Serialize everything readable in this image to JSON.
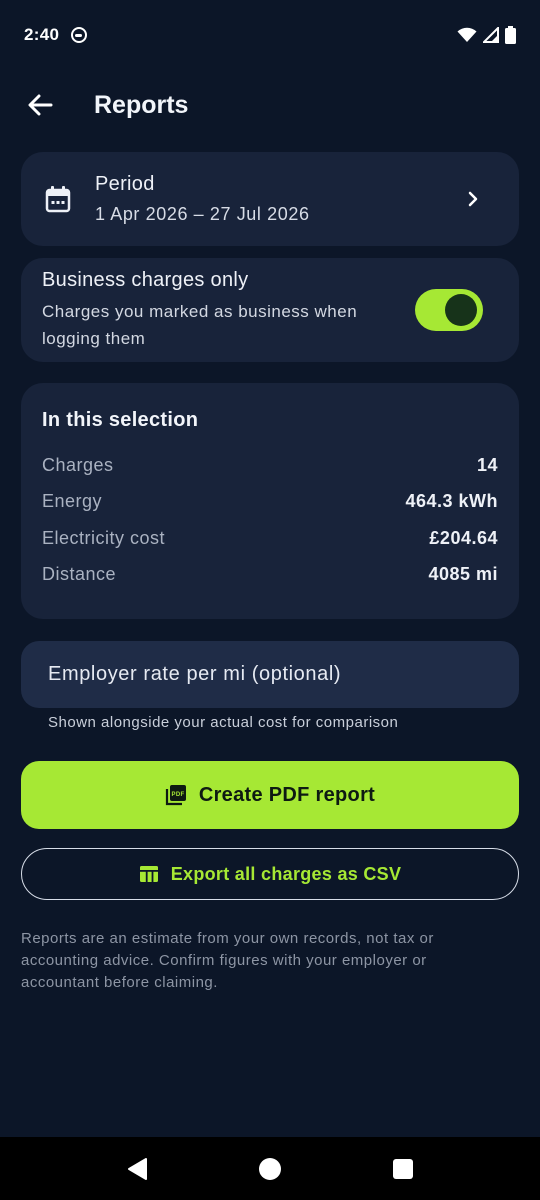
{
  "status_bar": {
    "time": "2:40",
    "icons": [
      "notification-icon",
      "wifi-icon",
      "signal-icon",
      "battery-icon"
    ]
  },
  "app_bar": {
    "title": "Reports",
    "back_icon": "arrow-back-icon"
  },
  "period": {
    "label": "Period",
    "value": "1 Apr 2026 – 27 Jul 2026",
    "icon": "calendar-icon"
  },
  "business_filter": {
    "title": "Business charges only",
    "subtitle": "Charges you marked as business when logging them",
    "enabled": true
  },
  "summary": {
    "title": "In this selection",
    "rows": [
      {
        "label": "Charges",
        "value": "14"
      },
      {
        "label": "Energy",
        "value": "464.3 kWh"
      },
      {
        "label": "Electricity cost",
        "value": "£204.64"
      },
      {
        "label": "Distance",
        "value": "4085 mi"
      }
    ]
  },
  "employer_rate": {
    "placeholder": "Employer rate per mi (optional)",
    "helper": "Shown alongside your actual cost for comparison"
  },
  "actions": {
    "pdf_label": "Create PDF report",
    "csv_label": "Export all charges as CSV"
  },
  "disclaimer": "Reports are an estimate from your own records, not tax or accounting advice. Confirm figures with your employer or accountant before claiming.",
  "colors": {
    "background": "#0c1628",
    "card": "#18233a",
    "accent": "#a6e834",
    "muted": "#8d95a4"
  }
}
